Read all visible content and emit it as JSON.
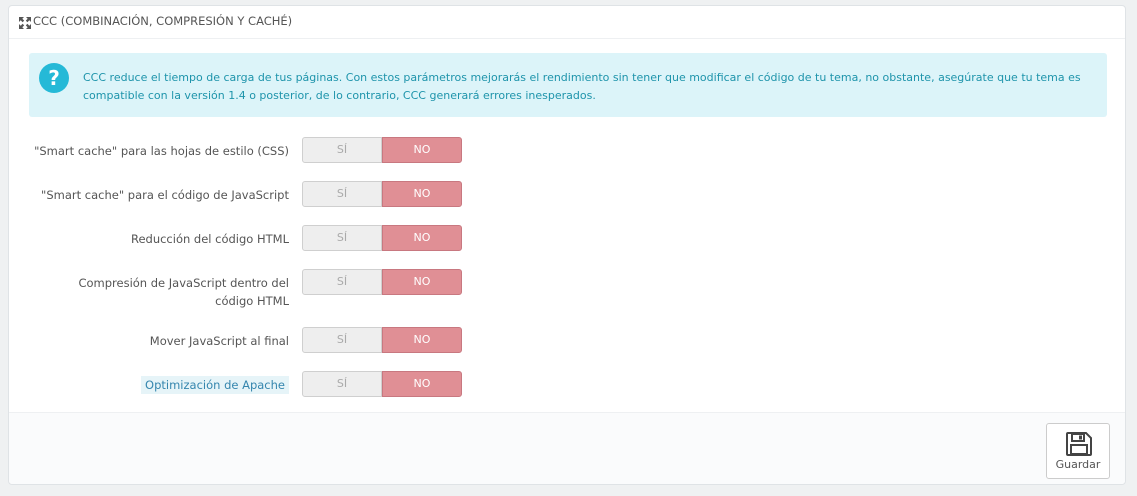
{
  "panel": {
    "title": "CCC (COMBINACIÓN, COMPRESIÓN Y CACHÉ)",
    "title_icon": "resize-arrows-icon"
  },
  "alert": {
    "icon": "question-circle-icon",
    "text": "CCC reduce el tiempo de carga de tus páginas. Con estos parámetros mejorarás el rendimiento sin tener que modificar el código de tu tema, no obstante, asegúrate que tu tema es compatible con la versión 1.4 o posterior, de lo contrario, CCC generará errores inesperados."
  },
  "options": [
    {
      "label": "\"Smart cache\" para las hojas de estilo (CSS)",
      "yes": "SÍ",
      "no": "NO",
      "selected": "NO"
    },
    {
      "label": "\"Smart cache\" para el código de JavaScript",
      "yes": "SÍ",
      "no": "NO",
      "selected": "NO"
    },
    {
      "label": "Reducción del código HTML",
      "yes": "SÍ",
      "no": "NO",
      "selected": "NO"
    },
    {
      "label_line1": "Compresión de JavaScript dentro del",
      "label_line2": "código HTML",
      "yes": "SÍ",
      "no": "NO",
      "selected": "NO"
    },
    {
      "label": "Mover JavaScript al final",
      "yes": "SÍ",
      "no": "NO",
      "selected": "NO"
    },
    {
      "label": "Optimización de Apache",
      "yes": "SÍ",
      "no": "NO",
      "selected": "NO"
    }
  ],
  "footer": {
    "save_label": "Guardar",
    "save_icon": "floppy-disk-icon"
  },
  "colors": {
    "accent": "#25b9d7",
    "alert_bg": "#dcf4f9",
    "no_active": "#e08f95"
  }
}
